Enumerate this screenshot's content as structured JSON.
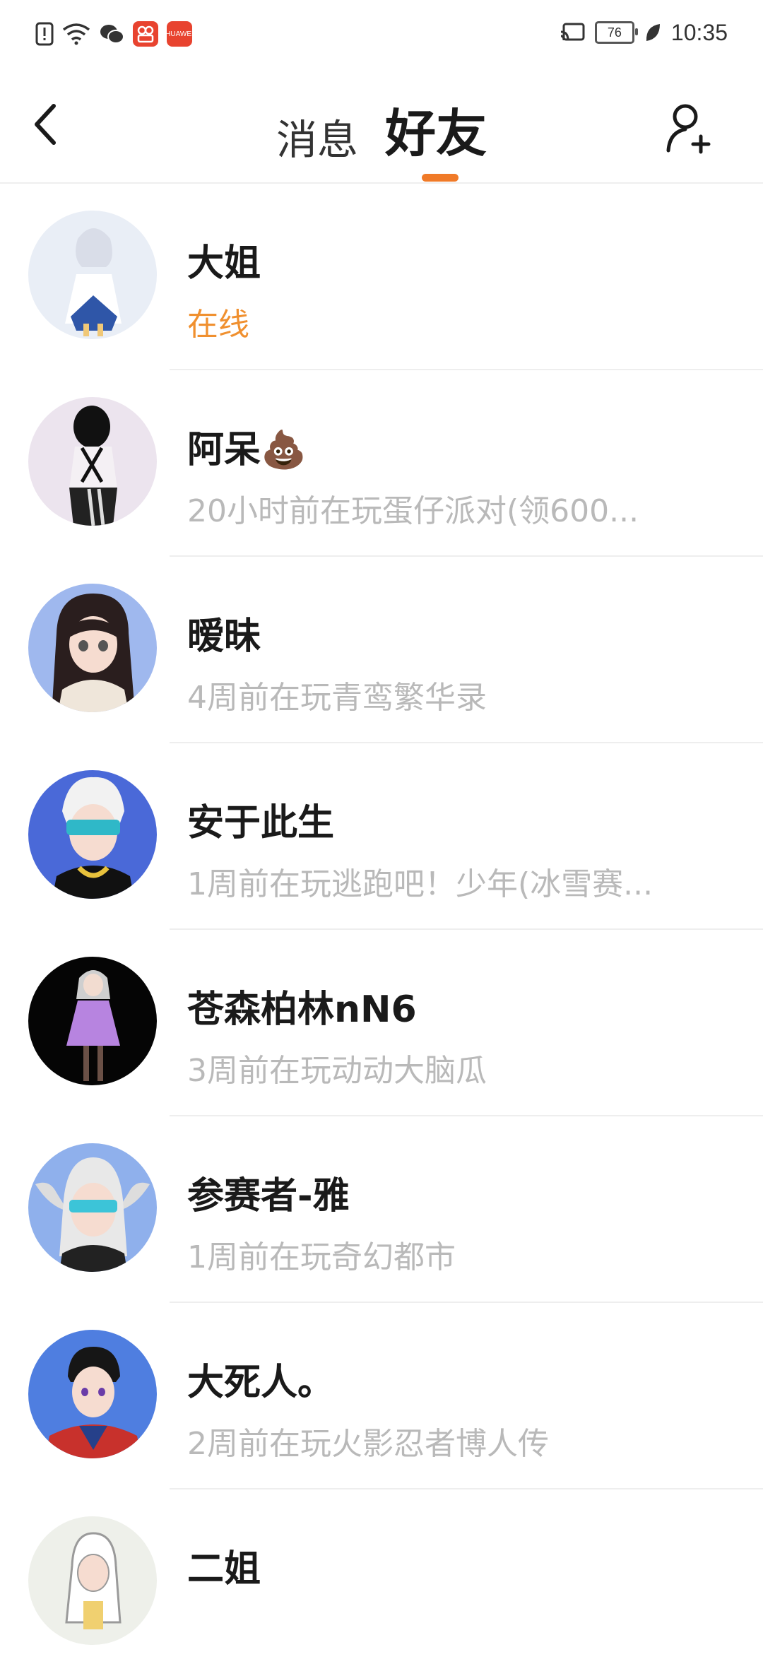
{
  "status_bar": {
    "time": "10:35",
    "battery": "76",
    "icons": [
      "alert-icon",
      "wifi-icon",
      "wechat-icon",
      "app-icon",
      "huawei-icon",
      "cast-icon",
      "battery-icon",
      "leaf-icon"
    ],
    "huawei_label": "HUAWEI"
  },
  "header": {
    "tabs": [
      {
        "label": "消息",
        "active": false
      },
      {
        "label": "好友",
        "active": true
      }
    ],
    "accent_color": "#f07a28"
  },
  "friends": [
    {
      "name": "大姐",
      "status": "在线",
      "online": true
    },
    {
      "name": "阿呆💩",
      "status": "20小时前在玩蛋仔派对(领600...",
      "online": false
    },
    {
      "name": "暧昧",
      "status": "4周前在玩青鸾繁华录",
      "online": false
    },
    {
      "name": "安于此生",
      "status": "1周前在玩逃跑吧！少年(冰雪赛...",
      "online": false
    },
    {
      "name": "苍森柏林nN6",
      "status": "3周前在玩动动大脑瓜",
      "online": false
    },
    {
      "name": "参赛者-雅",
      "status": "1周前在玩奇幻都市",
      "online": false
    },
    {
      "name": "大死人。",
      "status": "2周前在玩火影忍者博人传",
      "online": false
    },
    {
      "name": "二姐",
      "status": "",
      "online": false
    }
  ]
}
